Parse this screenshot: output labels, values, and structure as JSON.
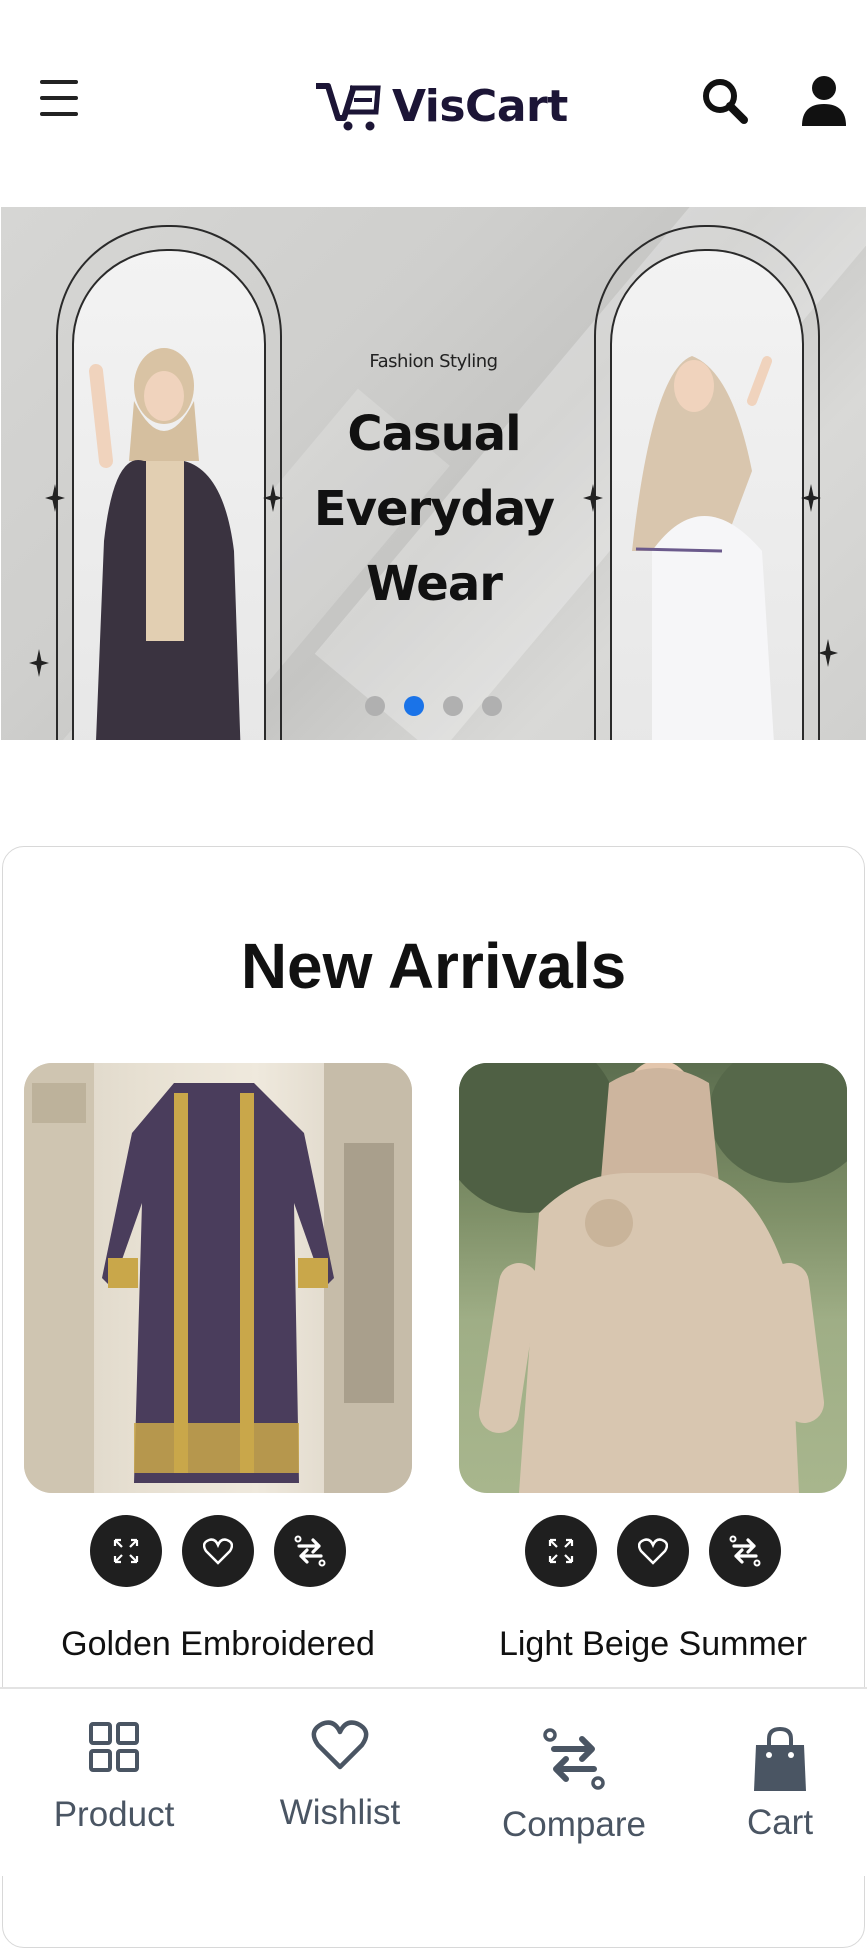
{
  "header": {
    "brand_name": "VisCart",
    "menu_icon": "hamburger-menu-icon",
    "search_icon": "search-icon",
    "user_icon": "user-icon"
  },
  "banner": {
    "tagline": "Fashion Styling",
    "title_lines": [
      "Casual",
      "Everyday",
      "Wear"
    ],
    "slide_count": 4,
    "active_slide": 2
  },
  "new_arrivals": {
    "title": "New Arrivals",
    "products": [
      {
        "name": "Golden Embroidered",
        "colors": {
          "garment": "#4a3d5c",
          "trim": "#c9a74a"
        }
      },
      {
        "name": "Light Beige Summer",
        "colors": {
          "garment": "#d8c6b0",
          "scarf": "#cdb59e"
        }
      }
    ],
    "action_icons": [
      "expand-icon",
      "heart-icon",
      "compare-icon"
    ]
  },
  "bottom_nav": {
    "items": [
      {
        "label": "Product",
        "icon": "grid-icon"
      },
      {
        "label": "Wishlist",
        "icon": "heart-icon"
      },
      {
        "label": "Compare",
        "icon": "compare-icon"
      },
      {
        "label": "Cart",
        "icon": "shopping-bag-icon"
      }
    ]
  },
  "colors": {
    "brand": "#1c1536",
    "active_dot": "#1a73e8",
    "nav_text": "#4a5563",
    "action_button": "#1f1f1f"
  }
}
